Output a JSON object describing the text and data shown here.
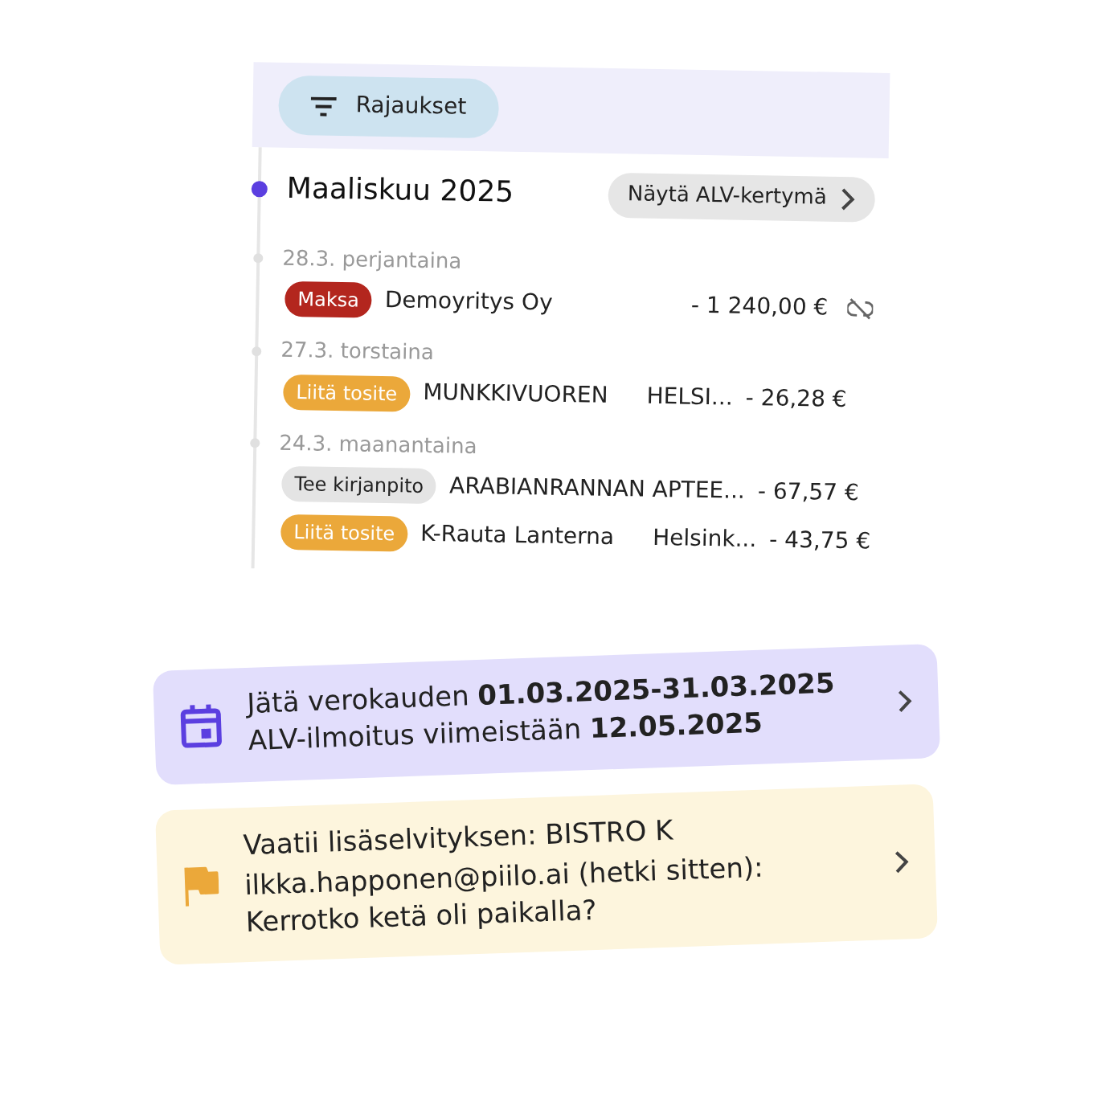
{
  "filter_button": {
    "label": "Rajaukset"
  },
  "month": {
    "title": "Maaliskuu 2025",
    "button": "Näytä ALV-kertymä"
  },
  "days": [
    {
      "date": "28.3. perjantaina",
      "transactions": [
        {
          "badge": {
            "label": "Maksa",
            "kind": "pay"
          },
          "name": "Demoyritys Oy",
          "amount": "- 1 240,00 €",
          "unlinked": true
        }
      ]
    },
    {
      "date": "27.3. torstaina",
      "transactions": [
        {
          "badge": {
            "label": "Liitä tosite",
            "kind": "attach"
          },
          "name": "MUNKKIVUOREN",
          "location": "HELSI...",
          "amount": "- 26,28 €",
          "unlinked": false
        }
      ]
    },
    {
      "date": "24.3. maanantaina",
      "transactions": [
        {
          "badge": {
            "label": "Tee kirjanpito",
            "kind": "book"
          },
          "name": "ARABIANRANNAN APTEE...",
          "amount": "- 67,57 €",
          "unlinked": false
        },
        {
          "badge": {
            "label": "Liitä tosite",
            "kind": "attach"
          },
          "name": "K-Rauta Lanterna",
          "location": "Helsink...",
          "amount": "- 43,75 €",
          "unlinked": false
        }
      ]
    }
  ],
  "notices": [
    {
      "kind": "deadline",
      "text": "Jätä verokauden **01.03.2025-31.03.2025** ALV-ilmoitus viimeistään **12.05.2025**"
    },
    {
      "kind": "clarification",
      "title": "Vaatii lisäselvityksen: BISTRO K",
      "text": "ilkka.happonen@piilo.ai (hetki sitten): Kerrotko ketä oli paikalla?"
    }
  ]
}
